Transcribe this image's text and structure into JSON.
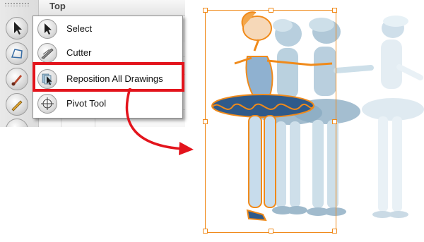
{
  "panel": {
    "view_tab_label": "Top",
    "strip_buttons": [
      "arrow-tool-icon",
      "contour-editor-icon",
      "brush-icon",
      "pencil-icon",
      "paint-icon"
    ]
  },
  "menu": {
    "items": [
      {
        "label": "Select",
        "icon": "arrow-select-icon"
      },
      {
        "label": "Cutter",
        "icon": "cutter-icon"
      },
      {
        "label": "Reposition All Drawings",
        "icon": "reposition-all-drawings-icon"
      },
      {
        "label": "Pivot Tool",
        "icon": "pivot-crosshair-icon"
      }
    ],
    "highlighted_index": 2
  },
  "colors": {
    "highlight": "#e3141c",
    "arrow": "#e3141c",
    "bounding_box": "#f08a1a",
    "character_outline": "#f08a1a",
    "ghost_figures": "#b9d2e0",
    "tutu": "#2f5a8a"
  }
}
